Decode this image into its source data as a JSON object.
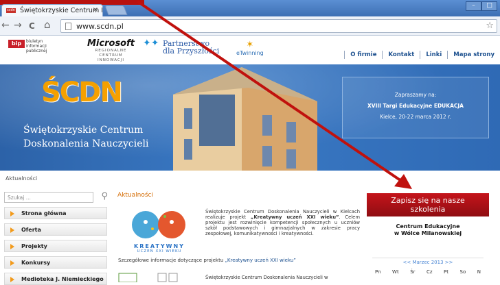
{
  "browser": {
    "tab_title": "Świętokrzyskie Centrum D",
    "tab_close": "×",
    "favicon_text": "scdn",
    "url": "www.scdn.pl",
    "win_min": "–",
    "win_max": "□",
    "nav_back": "←",
    "nav_forward": "→",
    "nav_reload": "C",
    "nav_home": "⌂",
    "star": "☆"
  },
  "header": {
    "bip_badge": "bip",
    "bip_text_1": "biuletyn",
    "bip_text_2": "informacji publicznej",
    "microsoft": "Microsoft",
    "microsoft_sub_1": "REGIONALNE",
    "microsoft_sub_2": "CENTRUM",
    "microsoft_sub_3": "INNOWACJI",
    "partnerstwo_1": "Partnerstwo",
    "partnerstwo_2": "dla Przyszłości",
    "etwinning": "eTwinning",
    "menu": [
      "O firmie",
      "Kontakt",
      "Linki",
      "Mapa strony"
    ]
  },
  "banner": {
    "logo": "ŚCDN",
    "title_1": "Świętokrzyskie Centrum",
    "title_2": "Doskonalenia Nauczycieli",
    "promo_1": "Zapraszamy na:",
    "promo_2": "XVIII Targi Edukacyjne EDUKACJA",
    "promo_3": "Kielce, 20-22 marca 2012 r."
  },
  "breadcrumb": "Aktualności",
  "sidebar": {
    "search_placeholder": "Szukaj ...",
    "items": [
      "Strona główna",
      "Oferta",
      "Projekty",
      "Konkursy",
      "Medioteka J. Niemieckiego"
    ]
  },
  "content": {
    "heading": "Aktualności",
    "kub_logo_1": "KREATYWNY",
    "kub_logo_2": "UCZEŃ XXI WIEKU",
    "para1_a": "Świętokrzyskie Centrum Doskonalenia Nauczycieli w Kielcach realizuje projekt ",
    "para1_bold": "„Kreatywny uczeń XXI wieku”",
    "para1_b": ". Celem projektu jest rozwinięcie kompetencji społecznych u uczniów szkół podstawowych i gimnazjalnych w zakresie pracy zespołowej, komunikatywności i kreatywności.",
    "more_text": "Szczegółowe informacje dotyczące projektu ",
    "more_link": "„Kreatywny uczeń XXI wieku”",
    "para2": "Świętokrzyskie Centrum Doskonalenia Nauczycieli w"
  },
  "right": {
    "zapisz_1": "Zapisz się na nasze",
    "zapisz_2": "szkolenia",
    "centrum_1": "Centrum Edukacyjne",
    "centrum_2": "w Wólce Milanowskiej",
    "cal_month": "<< Marzec 2013 >>",
    "cal_days": [
      "Pn",
      "Wt",
      "Śr",
      "Cz",
      "Pt",
      "So",
      "N"
    ]
  },
  "colors": {
    "accent_orange": "#d46a00",
    "zapisz_red": "#b8120f",
    "link_blue": "#1b4f8e",
    "banner_blue": "#3a79c4"
  }
}
